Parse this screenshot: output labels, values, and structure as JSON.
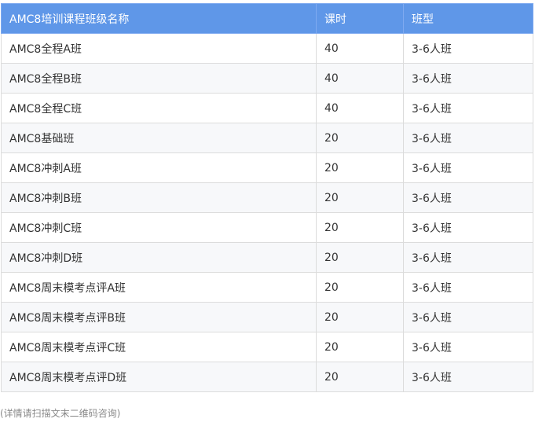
{
  "table": {
    "headers": {
      "name": "AMC8培训课程班级名称",
      "hours": "课时",
      "type": "班型"
    },
    "rows": [
      {
        "name": "AMC8全程A班",
        "hours": "40",
        "type": "3-6人班"
      },
      {
        "name": "AMC8全程B班",
        "hours": "40",
        "type": "3-6人班"
      },
      {
        "name": "AMC8全程C班",
        "hours": "40",
        "type": "3-6人班"
      },
      {
        "name": "AMC8基础班",
        "hours": "20",
        "type": "3-6人班"
      },
      {
        "name": "AMC8冲刺A班",
        "hours": "20",
        "type": "3-6人班"
      },
      {
        "name": "AMC8冲刺B班",
        "hours": "20",
        "type": "3-6人班"
      },
      {
        "name": "AMC8冲刺C班",
        "hours": "20",
        "type": "3-6人班"
      },
      {
        "name": "AMC8冲刺D班",
        "hours": "20",
        "type": "3-6人班"
      },
      {
        "name": "AMC8周末模考点评A班",
        "hours": "20",
        "type": "3-6人班"
      },
      {
        "name": "AMC8周末模考点评B班",
        "hours": "20",
        "type": "3-6人班"
      },
      {
        "name": "AMC8周末模考点评C班",
        "hours": "20",
        "type": "3-6人班"
      },
      {
        "name": "AMC8周末模考点评D班",
        "hours": "20",
        "type": "3-6人班"
      }
    ]
  },
  "footnote": "(详情请扫描文末二维码咨询)"
}
